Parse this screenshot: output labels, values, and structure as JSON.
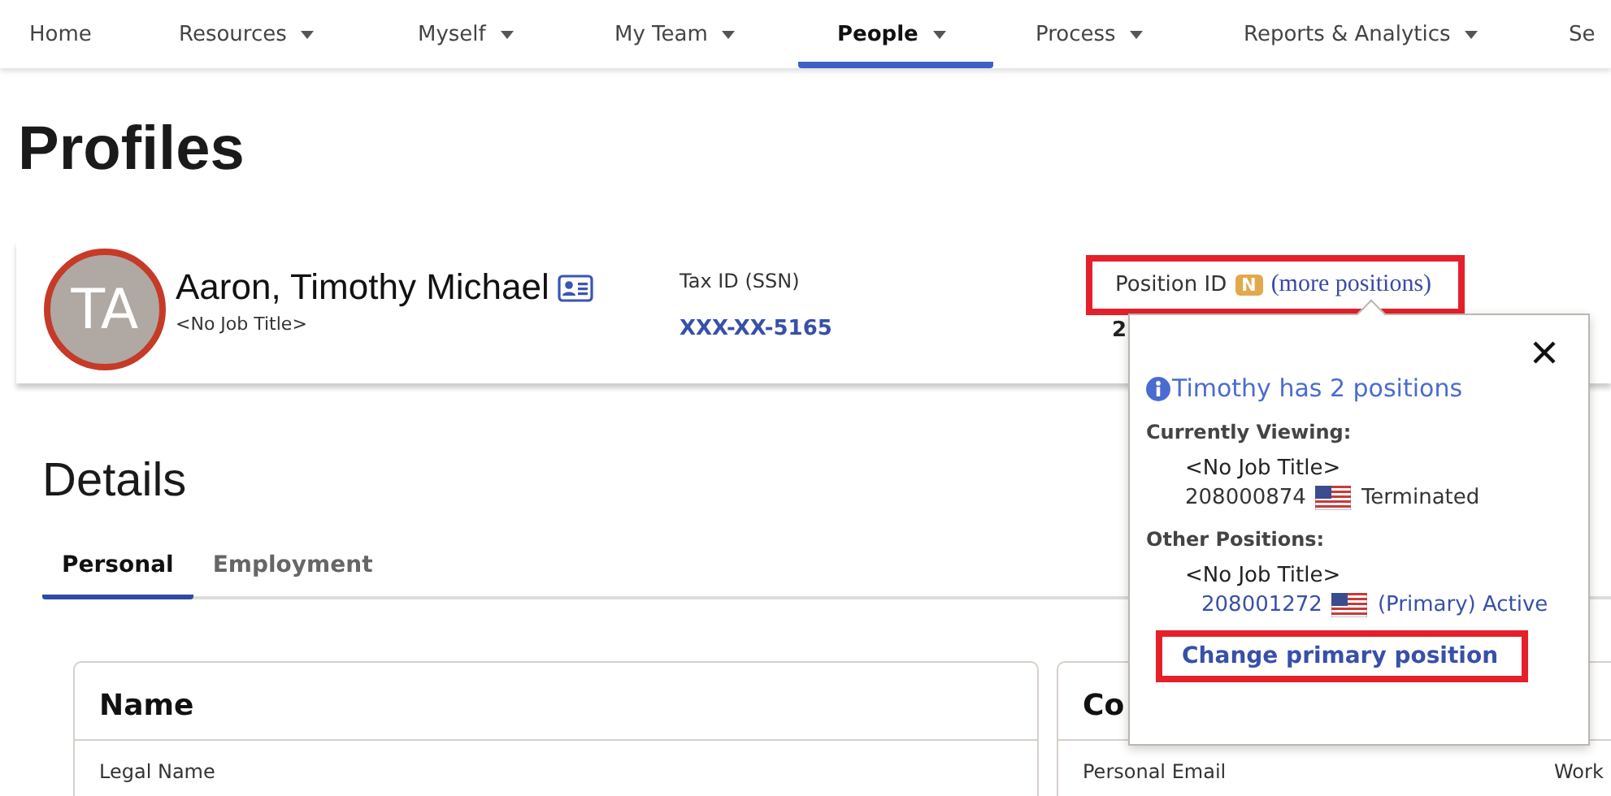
{
  "nav": [
    {
      "label": "Home",
      "has_menu": false,
      "selected": false
    },
    {
      "label": "Resources",
      "has_menu": true,
      "selected": false
    },
    {
      "label": "Myself",
      "has_menu": true,
      "selected": false
    },
    {
      "label": "My Team",
      "has_menu": true,
      "selected": false
    },
    {
      "label": "People",
      "has_menu": true,
      "selected": true
    },
    {
      "label": "Process",
      "has_menu": true,
      "selected": false
    },
    {
      "label": "Reports & Analytics",
      "has_menu": true,
      "selected": false
    },
    {
      "label": "Se",
      "has_menu": false,
      "selected": false
    }
  ],
  "page_title": "Profiles",
  "profile": {
    "initials": "TA",
    "name": "Aaron, Timothy Michael",
    "job_title": "<No Job Title>",
    "tax_id_label": "Tax ID (SSN)",
    "tax_id": "XXX-XX-5165",
    "position_label": "Position ID",
    "position_badge": "N",
    "more_link": "(more positions)",
    "position_value": "2",
    "highlighted": true
  },
  "popup": {
    "heading": "Timothy has 2 positions",
    "sections": [
      {
        "label": "Currently Viewing:",
        "positions": [
          {
            "title": "<No Job Title>",
            "id": "208000874",
            "status": "Terminated",
            "link": false
          }
        ]
      },
      {
        "label": "Other Positions:",
        "positions": [
          {
            "title": "<No Job Title>",
            "id": "208001272",
            "status": "(Primary) Active",
            "link": true
          }
        ]
      }
    ],
    "action": {
      "label": "Change primary position",
      "highlighted": true
    }
  },
  "details": {
    "heading": "Details",
    "tabs": [
      {
        "label": "Personal",
        "selected": true
      },
      {
        "label": "Employment",
        "selected": false
      }
    ],
    "cards": [
      {
        "title": "Name",
        "fields": [
          "Legal Name"
        ]
      },
      {
        "title": "Co",
        "fields": [
          "Personal Email",
          "Work"
        ]
      }
    ]
  }
}
